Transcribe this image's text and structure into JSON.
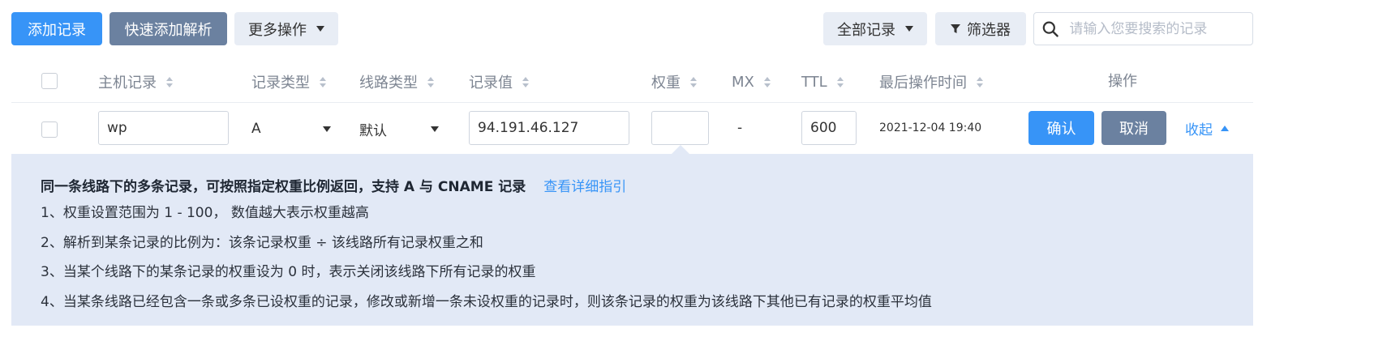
{
  "toolbar": {
    "add_record": "添加记录",
    "quick_add": "快速添加解析",
    "more_actions": "更多操作",
    "all_records": "全部记录",
    "filter": "筛选器",
    "search_placeholder": "请输入您要搜索的记录"
  },
  "table": {
    "headers": {
      "host": "主机记录",
      "type": "记录类型",
      "line": "线路类型",
      "value": "记录值",
      "weight": "权重",
      "mx": "MX",
      "ttl": "TTL",
      "last_modified": "最后操作时间",
      "actions": "操作"
    },
    "edit_row": {
      "host": "wp",
      "type": "A",
      "line": "默认",
      "value": "94.191.46.127",
      "weight": "",
      "mx": "-",
      "ttl": "600",
      "last_modified": "2021-12-04 19:40",
      "confirm": "确认",
      "cancel": "取消",
      "collapse": "收起"
    }
  },
  "info": {
    "title": "同一条线路下的多条记录，可按照指定权重比例返回，支持 A 与 CNAME 记录",
    "guide_link": "查看详细指引",
    "lines": [
      "1、权重设置范围为 1 - 100， 数值越大表示权重越高",
      "2、解析到某条记录的比例为：该条记录权重 ÷ 该线路所有记录权重之和",
      "3、当某个线路下的某条记录的权重设为 0 时，表示关闭该线路下所有记录的权重",
      "4、当某条线路已经包含一条或多条已设权重的记录，修改或新增一条未设权重的记录时，则该条记录的权重为该线路下其他已有记录的权重平均值"
    ]
  },
  "colors": {
    "primary": "#3794f7",
    "secondary": "#6b81a0",
    "panel": "#e2e9f6"
  }
}
